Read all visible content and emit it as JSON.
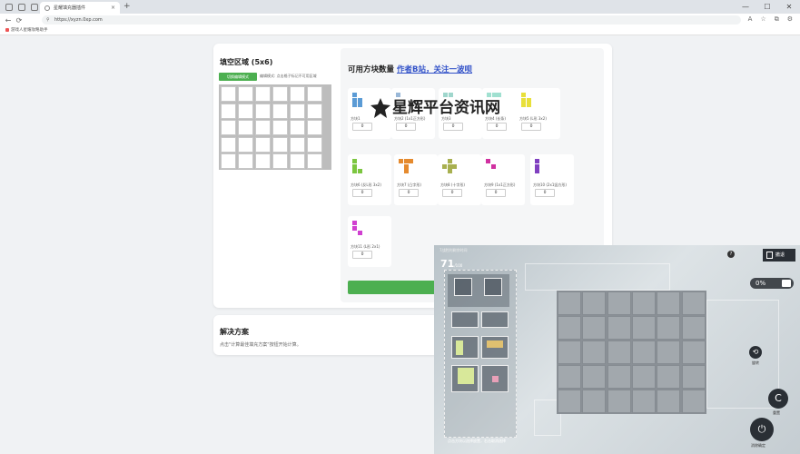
{
  "browser": {
    "tab_title": "星耀填充器插件",
    "tab_close": "×",
    "new_tab": "+",
    "url": "https://xyzn.0xp.com",
    "minimize": "—",
    "maximize": "☐",
    "close": "✕",
    "back": "←",
    "reload": "⟳",
    "bookmark": "游戏人星耀攻略助手",
    "tools": [
      "A",
      "☆",
      "⧉",
      "⚙"
    ]
  },
  "fill_area": {
    "title": "填空区域 (5x6)",
    "mode_button": "切换编辑模式",
    "hint": "编辑模式: 点击格子标记不可用区域"
  },
  "available": {
    "title": "可用方块数量",
    "author_link": "作者B站，关注一波呗",
    "pieces": [
      {
        "label": "方块1",
        "count": "0",
        "color": "#5b9bd5"
      },
      {
        "label": "方块2 (1x1正方形)",
        "count": "0",
        "color": "#9ab8d8"
      },
      {
        "label": "方块3",
        "count": "0",
        "color": "#9fd6cc"
      },
      {
        "label": "方块4 (长条)",
        "count": "0",
        "color": "#a0e0d0"
      },
      {
        "label": "方块5 (L形 3x2)",
        "count": "0",
        "color": "#e8e03a"
      },
      {
        "label": "方块6 (反L形 3x2)",
        "count": "0",
        "color": "#7cc640"
      },
      {
        "label": "方块7 (凸字形)",
        "count": "0",
        "color": "#e58a2e"
      },
      {
        "label": "方块8 (十字形)",
        "count": "0",
        "color": "#a8b050"
      },
      {
        "label": "方块9 (1x1正方形)",
        "count": "0",
        "color": "#d030a0"
      },
      {
        "label": "方块10 (2x1竖方形)",
        "count": "0",
        "color": "#8040c0"
      },
      {
        "label": "方块11 (L形 2x1)",
        "count": "0",
        "color": "#d040d0"
      }
    ]
  },
  "watermark": "星辉平台资讯网",
  "solution": {
    "title": "解决方案",
    "hint": "点击\"计算最佳填充方案\"按钮开始计算。"
  },
  "game": {
    "header": "7战胜利剩余时间",
    "count": "71",
    "count_unit": "/100",
    "exit": "撤退",
    "help": "?",
    "percent": "0%",
    "rotate": "旋转",
    "reset": "重置",
    "confirm": "消除确定",
    "footer": "点击方块以选择放置，右击取消选择"
  }
}
